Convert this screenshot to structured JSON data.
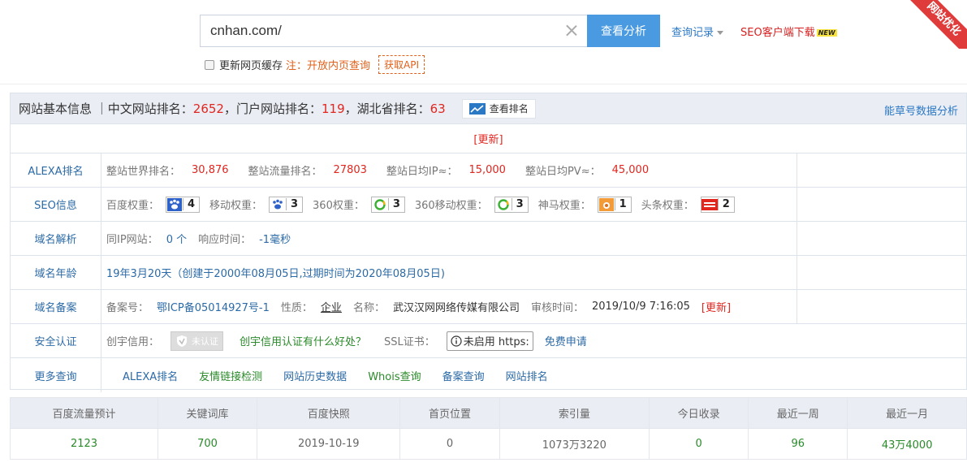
{
  "search": {
    "value": "cnhan.com/",
    "button_label": "查看分析",
    "history_label": "查询记录",
    "download_label": "SEO客户端下载",
    "new_badge": "NEW",
    "cache_label": "更新网页缓存",
    "hint": "注：开放内页查询",
    "api_label": "获取API"
  },
  "ribbon": "网站优化",
  "header": {
    "title_prefix": "网站基本信息 ｜中文网站排名：",
    "cn_rank": "2652",
    "portal_label": "，门户网站排名：",
    "portal_rank": "119",
    "province_label": "，湖北省排名：",
    "province_rank": "63",
    "rank_button": "查看排名",
    "nbh_link": "能草号数据分析",
    "update": "[更新]"
  },
  "alexa": {
    "label": "ALEXA排名",
    "world_label": "整站世界排名：",
    "world_value": "30,876",
    "traffic_label": "整站流量排名：",
    "traffic_value": "27803",
    "ip_label": "整站日均IP≈：",
    "ip_value": "15,000",
    "pv_label": "整站日均PV≈：",
    "pv_value": "45,000"
  },
  "seo": {
    "label": "SEO信息",
    "weights": [
      {
        "name": "百度权重：",
        "icon": "baidu-paw-icon",
        "value": "4"
      },
      {
        "name": "移动权重：",
        "icon": "baidu-paw-icon",
        "value": "3"
      },
      {
        "name": "360权重：",
        "icon": "360-icon",
        "value": "3"
      },
      {
        "name": "360移动权重：",
        "icon": "360-icon",
        "value": "3"
      },
      {
        "name": "神马权重：",
        "icon": "shenma-icon",
        "value": "1"
      },
      {
        "name": "头条权重：",
        "icon": "toutiao-icon",
        "value": "2"
      }
    ]
  },
  "domain_resolve": {
    "label": "域名解析",
    "ip_sites_label": "同IP网站：",
    "ip_sites_value": "0 个",
    "response_label": "响应时间：",
    "response_value": "-1毫秒"
  },
  "domain_age": {
    "label": "域名年龄",
    "value": "19年3月20天（创建于2000年08月05日,过期时间为2020年08月05日)"
  },
  "beian": {
    "label": "域名备案",
    "no_label": "备案号：",
    "no_value": "鄂ICP备05014927号-1",
    "type_label": "性质：",
    "type_value": "企业",
    "name_label": "名称：",
    "name_value": "武汉汉网网络传媒有限公司",
    "audit_label": "审核时间：",
    "audit_value": "2019/10/9 7:16:05",
    "update": "[更新]"
  },
  "security": {
    "label": "安全认证",
    "credit_label": "创宇信用：",
    "cert_text": "未认证",
    "credit_link": "创宇信用认证有什么好处？",
    "ssl_label": "SSL证书：",
    "ssl_value": "未启用 https:",
    "ssl_apply": "免费申请"
  },
  "more": {
    "label": "更多查询",
    "links": [
      "ALEXA排名",
      "友情链接检测",
      "网站历史数据",
      "Whois查询",
      "备案查询",
      "网站排名"
    ]
  },
  "stats": {
    "headers": [
      "百度流量预计",
      "关键词库",
      "百度快照",
      "首页位置",
      "索引量",
      "今日收录",
      "最近一周",
      "最近一月"
    ],
    "values": [
      "2123",
      "700",
      "2019-10-19",
      "0",
      "1073万3220",
      "0",
      "96",
      "43万4000"
    ]
  }
}
